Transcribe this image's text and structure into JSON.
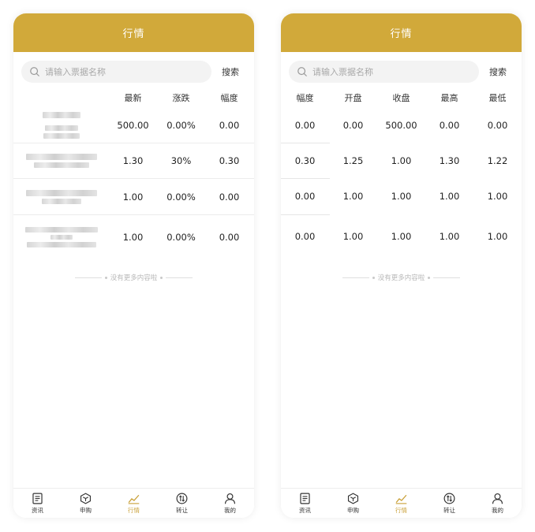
{
  "left": {
    "header_title": "行情",
    "search_placeholder": "请输入票据名称",
    "search_button": "搜索",
    "columns": [
      "最新",
      "涨跌",
      "幅度"
    ],
    "rows": [
      {
        "latest": "500.00",
        "change": "0.00%",
        "amplitude": "0.00"
      },
      {
        "latest": "1.30",
        "change": "30%",
        "amplitude": "0.30"
      },
      {
        "latest": "1.00",
        "change": "0.00%",
        "amplitude": "0.00"
      },
      {
        "latest": "1.00",
        "change": "0.00%",
        "amplitude": "0.00"
      }
    ],
    "no_more": "没有更多内容啦"
  },
  "right": {
    "header_title": "行情",
    "search_placeholder": "请输入票据名称",
    "search_button": "搜索",
    "columns": [
      "幅度",
      "开盘",
      "收盘",
      "最高",
      "最低"
    ],
    "rows": [
      {
        "amplitude": "0.00",
        "open": "0.00",
        "close": "500.00",
        "high": "0.00",
        "low": "0.00"
      },
      {
        "amplitude": "0.30",
        "open": "1.25",
        "close": "1.00",
        "high": "1.30",
        "low": "1.22"
      },
      {
        "amplitude": "0.00",
        "open": "1.00",
        "close": "1.00",
        "high": "1.00",
        "low": "1.00"
      },
      {
        "amplitude": "0.00",
        "open": "1.00",
        "close": "1.00",
        "high": "1.00",
        "low": "1.00"
      }
    ],
    "no_more": "没有更多内容啦"
  },
  "tabbar": {
    "items": [
      {
        "label": "资讯",
        "icon": "news-icon"
      },
      {
        "label": "申购",
        "icon": "cube-icon"
      },
      {
        "label": "行情",
        "icon": "chart-line-icon"
      },
      {
        "label": "转让",
        "icon": "transfer-icon"
      },
      {
        "label": "我的",
        "icon": "user-icon"
      }
    ],
    "active_index": 2
  },
  "colors": {
    "accent": "#d1a93a",
    "active_tab": "#c9a038"
  }
}
